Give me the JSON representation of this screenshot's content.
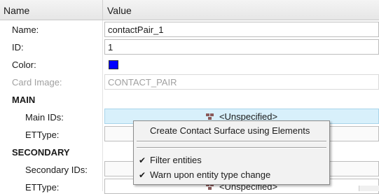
{
  "header": {
    "name_col": "Name",
    "value_col": "Value"
  },
  "rows": {
    "name": {
      "label": "Name:",
      "value": "contactPair_1"
    },
    "id": {
      "label": "ID:",
      "value": "1"
    },
    "color": {
      "label": "Color:",
      "value": "#0000ff"
    },
    "card_image": {
      "label": "Card Image:",
      "value": "CONTACT_PAIR"
    }
  },
  "main": {
    "title": "MAIN",
    "main_ids": {
      "label": "Main IDs:",
      "value": "<Unspecified>"
    },
    "ettype": {
      "label": "ETType:"
    }
  },
  "secondary": {
    "title": "SECONDARY",
    "secondary_ids": {
      "label": "Secondary IDs:"
    },
    "ettype": {
      "label": "ETType:",
      "value": "<Unspecified>"
    }
  },
  "context_menu": {
    "item_create": "Create Contact Surface using Elements",
    "item_filter": "Filter entities",
    "item_filter_checked": true,
    "item_warn": "Warn upon entity type change",
    "item_warn_checked": true,
    "check_glyph": "✔"
  }
}
